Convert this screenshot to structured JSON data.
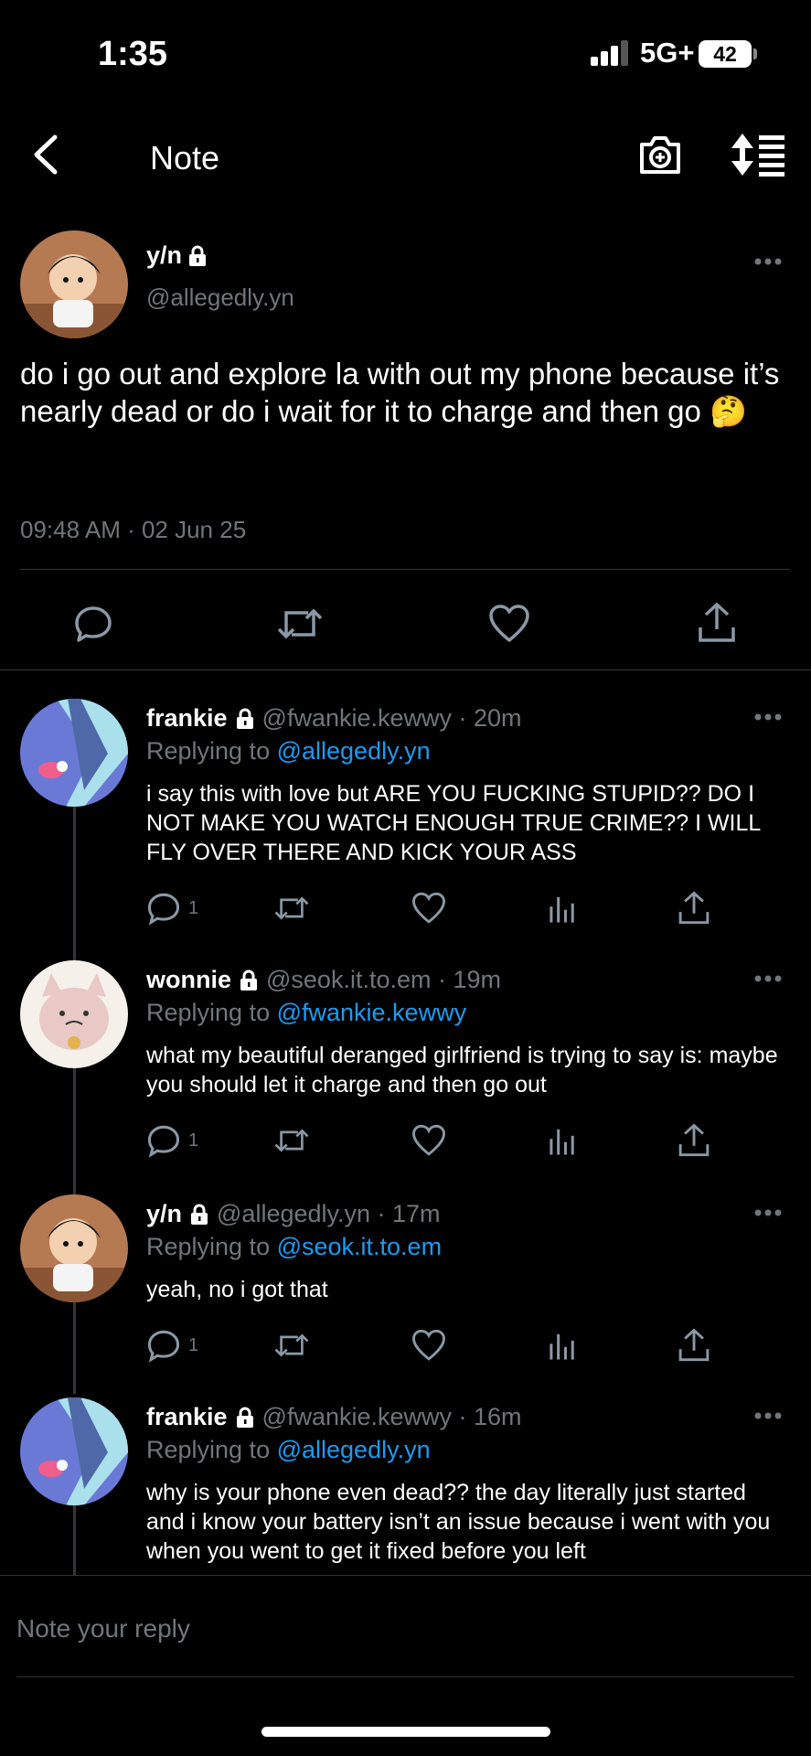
{
  "status_bar": {
    "time": "1:35",
    "network": "5G+",
    "battery": "42"
  },
  "nav": {
    "title": "Note"
  },
  "main_post": {
    "name": "y/n",
    "handle": "@allegedly.yn",
    "text": "do i go out and explore la with out my phone because it’s nearly dead or do i wait for it to charge and then go 🤔",
    "timestamp": "09:48 AM · 02 Jun 25"
  },
  "replies": [
    {
      "name": "frankie",
      "meta": "@fwankie.kewwy · 20m",
      "replying_prefix": "Replying to ",
      "replying_to": "@allegedly.yn",
      "text": "i say this with love but ARE YOU FUCKING STUPID?? DO I NOT MAKE YOU WATCH ENOUGH TRUE CRIME?? I WILL FLY OVER THERE AND KICK YOUR ASS",
      "reply_count": "1"
    },
    {
      "name": "wonnie",
      "meta": "@seok.it.to.em · 19m",
      "replying_prefix": "Replying to ",
      "replying_to": "@fwankie.kewwy",
      "text": "what my beautiful deranged girlfriend is trying to say is: maybe you should let it charge and then go out",
      "reply_count": "1"
    },
    {
      "name": "y/n",
      "meta": "@allegedly.yn · 17m",
      "replying_prefix": "Replying to ",
      "replying_to": "@seok.it.to.em",
      "text": "yeah, no i got that",
      "reply_count": "1"
    },
    {
      "name": "frankie",
      "meta": "@fwankie.kewwy · 16m",
      "replying_prefix": "Replying to ",
      "replying_to": "@allegedly.yn",
      "text": "why is your phone even dead?? the day literally just started and i know your battery isn’t an issue because i went with you when you went to get it fixed before you left"
    }
  ],
  "compose": {
    "placeholder": "Note your reply"
  },
  "colors": {
    "background": "#000000",
    "text": "#e7e9ea",
    "muted": "#71767b",
    "mention": "#1d9bf0",
    "divider": "#2f3336"
  }
}
